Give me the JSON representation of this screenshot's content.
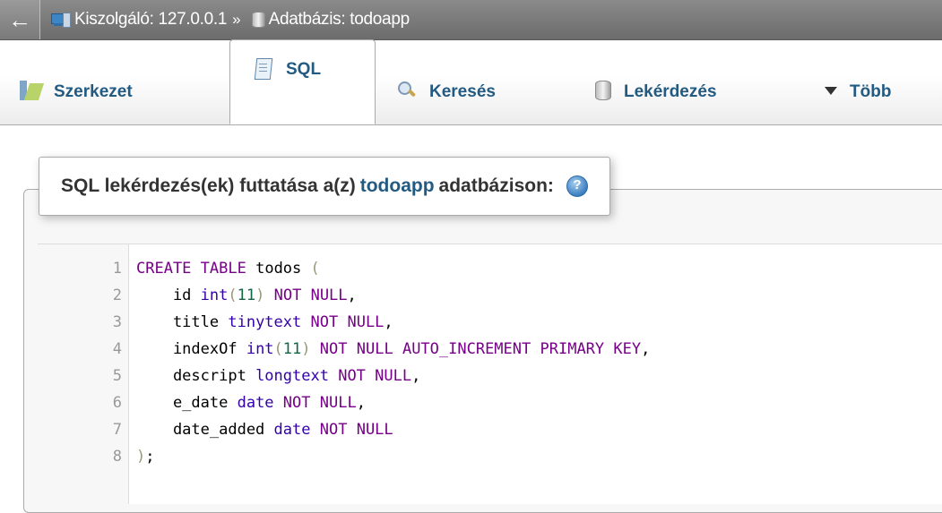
{
  "breadcrumb": {
    "back_glyph": "←",
    "server_label": "Kiszolgáló: 127.0.0.1",
    "separator": "»",
    "database_label": "Adatbázis: todoapp"
  },
  "tabs": [
    {
      "label": "Szerkezet",
      "icon": "structure-icon",
      "active": false
    },
    {
      "label": "SQL",
      "icon": "sql-icon",
      "active": true
    },
    {
      "label": "Keresés",
      "icon": "search-icon",
      "active": false
    },
    {
      "label": "Lekérdezés",
      "icon": "query-icon",
      "active": false
    },
    {
      "label": "Több",
      "icon": "more-dropdown-icon",
      "active": false
    }
  ],
  "sql_panel": {
    "title_prefix": "SQL lekérdezés(ek) futtatása a(z)",
    "database_name": "todoapp",
    "title_suffix": "adatbázison:"
  },
  "editor": {
    "lines": [
      {
        "n": "1",
        "text": "CREATE TABLE todos ("
      },
      {
        "n": "2",
        "text": "    id int(11) NOT NULL,"
      },
      {
        "n": "3",
        "text": "    title tinytext NOT NULL,"
      },
      {
        "n": "4",
        "text": "    indexOf int(11) NOT NULL AUTO_INCREMENT PRIMARY KEY,"
      },
      {
        "n": "5",
        "text": "    descript longtext NOT NULL,"
      },
      {
        "n": "6",
        "text": "    e_date date NOT NULL,"
      },
      {
        "n": "7",
        "text": "    date_added date NOT NULL"
      },
      {
        "n": "8",
        "text": ");"
      }
    ]
  },
  "colors": {
    "link": "#235a81",
    "keyword": "#770088",
    "type": "#3300aa",
    "number": "#116644"
  }
}
